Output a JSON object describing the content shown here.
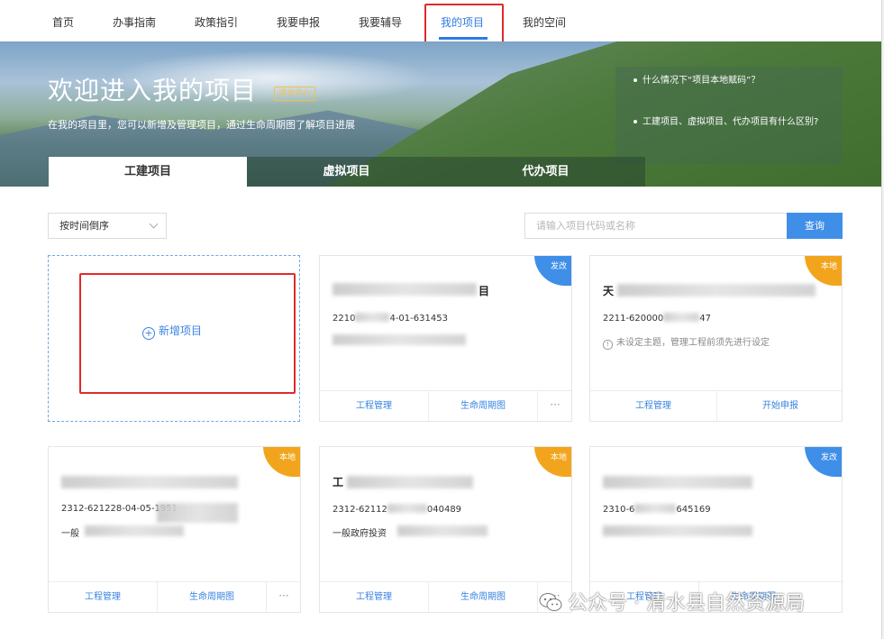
{
  "nav": {
    "items": [
      "首页",
      "办事指南",
      "政策指引",
      "我要申报",
      "我要辅导",
      "我的项目",
      "我的空间"
    ],
    "active_index": 5
  },
  "banner": {
    "title": "欢迎进入我的项目",
    "badge": "项目中心",
    "subtitle": "在我的项目里，您可以新增及管理项目，通过生命周期图了解项目进展",
    "faq": [
      "什么情况下“项目本地赋码”？",
      "工建项目、虚拟项目、代办项目有什么区别?"
    ]
  },
  "tabs": [
    "工建项目",
    "虚拟项目",
    "代办项目"
  ],
  "filter": {
    "selected": "按时间倒序"
  },
  "search": {
    "placeholder": "请输入项目代码或名称",
    "button": "查询"
  },
  "add_card": {
    "label": "新增项目"
  },
  "cards": [
    {
      "tag": "发改",
      "tag_color": "#3f8ee8",
      "title_tail": "目",
      "code": "2210",
      "code_tail": "4-01-631453",
      "actions": [
        "工程管理",
        "生命周期图"
      ],
      "more": "···"
    },
    {
      "tag": "本地",
      "tag_color": "#f2a51c",
      "title_head": "天",
      "code": "2211-620000",
      "code_tail": "47",
      "hint": "未设定主题，管理工程前须先进行设定",
      "actions": [
        "工程管理",
        "开始申报"
      ]
    },
    {
      "tag": "本地",
      "tag_color": "#f2a51c",
      "code": "2312-621228-04-05-1951",
      "line_head": "一般",
      "actions": [
        "工程管理",
        "生命周期图"
      ],
      "more": "···"
    },
    {
      "tag": "本地",
      "tag_color": "#f2a51c",
      "title_head": "工",
      "code": "2312-62112",
      "code_tail": "040489",
      "line": "一般政府投资",
      "actions": [
        "工程管理",
        "生命周期图"
      ],
      "more": "···"
    },
    {
      "tag": "发改",
      "tag_color": "#3f8ee8",
      "code": "2310-6",
      "code_tail": "645169",
      "actions": [
        "工程管理",
        "生命周期图"
      ]
    }
  ],
  "watermark": "公众号 · 清水县自然资源局"
}
